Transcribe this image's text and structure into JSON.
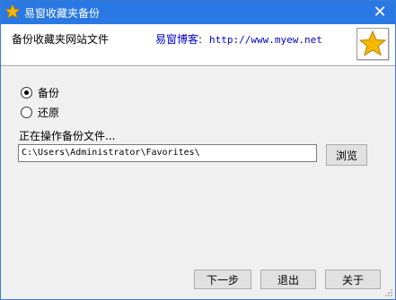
{
  "window": {
    "title": "易窗收藏夹备份",
    "close_symbol": "✕"
  },
  "header": {
    "subtitle": "备份收藏夹网站文件",
    "link_label": "易窗博客:",
    "link_url": "http://www.myew.net"
  },
  "options": {
    "backup_label": "备份",
    "restore_label": "还原",
    "selected": "backup"
  },
  "status_text": "正在操作备份文件...",
  "path_value": "C:\\Users\\Administrator\\Favorites\\",
  "buttons": {
    "browse": "浏览",
    "next": "下一步",
    "exit": "退出",
    "about": "关于"
  },
  "colors": {
    "titlebar": "#2a78e4",
    "link": "#0000c8",
    "star": "#f5b800"
  },
  "icons": {
    "app": "star-icon",
    "logo": "star-icon",
    "close": "close-icon"
  }
}
